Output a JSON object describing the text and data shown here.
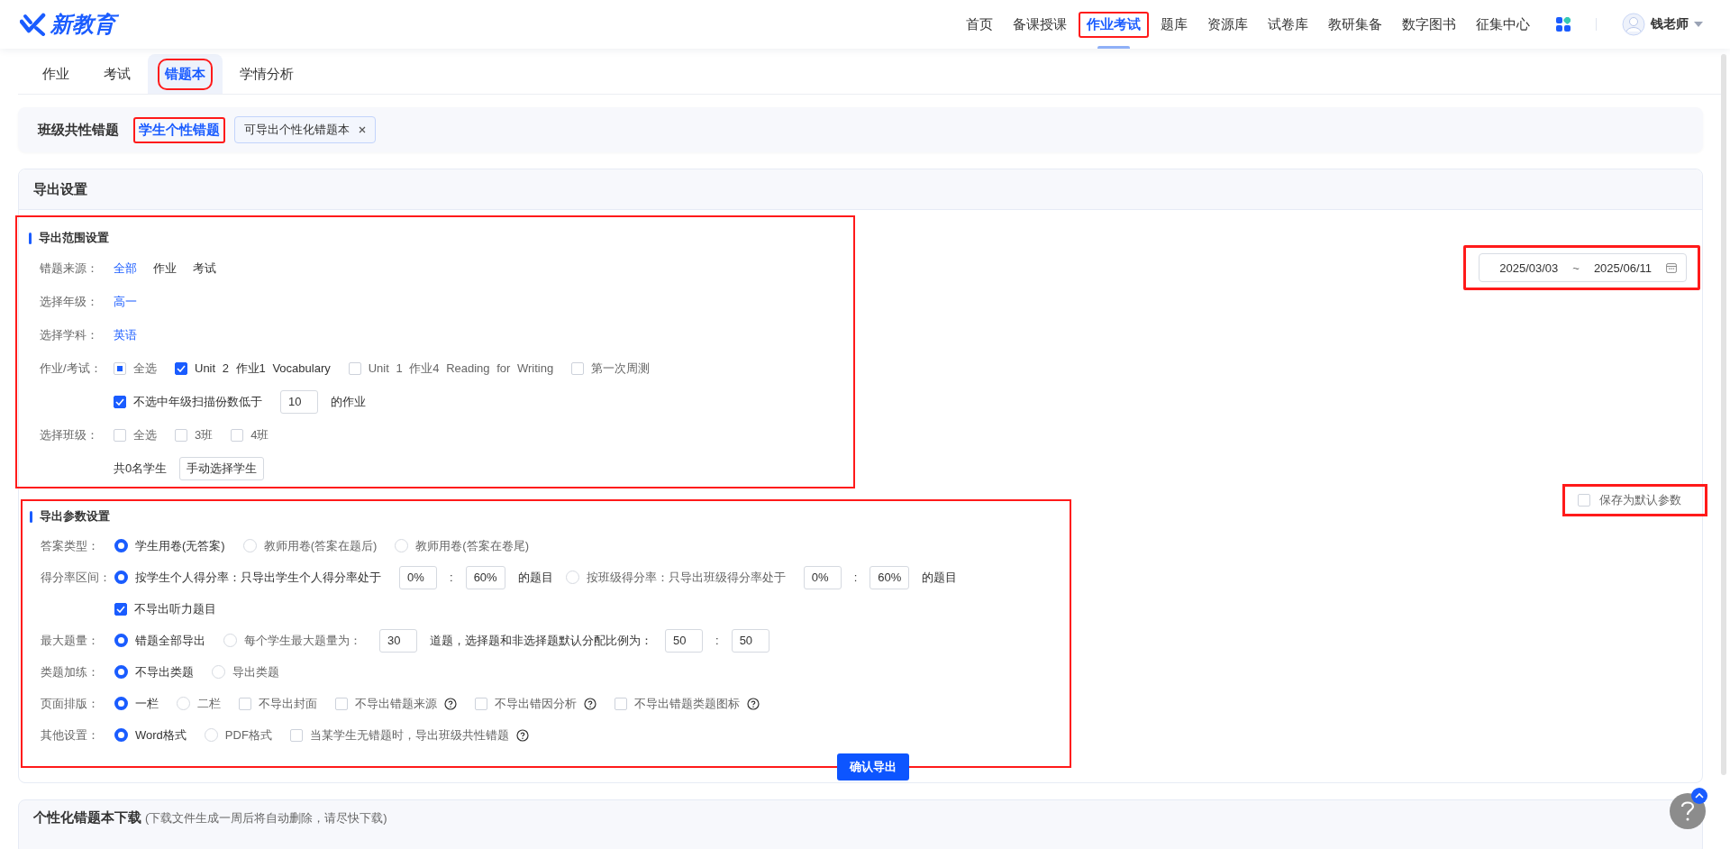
{
  "header": {
    "logo": "新教育",
    "nav": [
      {
        "label": "首页",
        "selected": false,
        "highlighted": false
      },
      {
        "label": "备课授课",
        "selected": false,
        "highlighted": false
      },
      {
        "label": "作业考试",
        "selected": true,
        "highlighted": true
      },
      {
        "label": "题库",
        "selected": false,
        "highlighted": false
      },
      {
        "label": "资源库",
        "selected": false,
        "highlighted": false
      },
      {
        "label": "试卷库",
        "selected": false,
        "highlighted": false
      },
      {
        "label": "教研集备",
        "selected": false,
        "highlighted": false
      },
      {
        "label": "数字图书",
        "selected": false,
        "highlighted": false
      },
      {
        "label": "征集中心",
        "selected": false,
        "highlighted": false
      }
    ],
    "user": {
      "name": "钱老师"
    }
  },
  "tabs": [
    {
      "label": "作业",
      "selected": false,
      "highlighted": false
    },
    {
      "label": "考试",
      "selected": false,
      "highlighted": false
    },
    {
      "label": "错题本",
      "selected": true,
      "highlighted": true
    },
    {
      "label": "学情分析",
      "selected": false,
      "highlighted": false
    }
  ],
  "subtabs": [
    {
      "label": "班级共性错题",
      "selected": false,
      "highlighted": false
    },
    {
      "label": "学生个性错题",
      "selected": true,
      "highlighted": true
    }
  ],
  "hint_tag": {
    "label": "可导出个性化错题本"
  },
  "export_settings": {
    "title": "导出设置",
    "date_range": {
      "start": "2025/03/03",
      "separator": "~",
      "end": "2025/06/11",
      "highlighted": true
    },
    "save_default": {
      "label": "保存为默认参数",
      "checked": false,
      "highlighted": true
    },
    "range_section": {
      "title": "导出范围设置",
      "highlighted": true,
      "rows": [
        {
          "label": "错题来源：",
          "items": [
            {
              "kind": "choice",
              "label": "全部",
              "selected": true
            },
            {
              "kind": "choice",
              "label": "作业",
              "selected": false
            },
            {
              "kind": "choice",
              "label": "考试",
              "selected": false
            }
          ]
        },
        {
          "label": "选择年级：",
          "items": [
            {
              "kind": "choice",
              "label": "高一",
              "selected": true
            }
          ]
        },
        {
          "label": "选择学科：",
          "items": [
            {
              "kind": "choice",
              "label": "英语",
              "selected": true
            }
          ]
        },
        {
          "label": "作业/考试：",
          "items": [
            {
              "kind": "checkbox",
              "label": "全选",
              "indeterminate": true
            },
            {
              "kind": "checkbox",
              "label": "Unit 2 作业1 Vocabulary",
              "checked": true
            },
            {
              "kind": "checkbox",
              "label": "Unit 1 作业4 Reading for Writing",
              "checked": false
            },
            {
              "kind": "checkbox",
              "label": "第一次周测",
              "checked": false
            }
          ]
        },
        {
          "items": [
            {
              "kind": "checkbox",
              "label": "不选中年级扫描份数低于",
              "checked": true
            },
            {
              "kind": "input",
              "value": "10"
            },
            {
              "kind": "text",
              "text": "的作业"
            }
          ]
        },
        {
          "label": "选择班级：",
          "items": [
            {
              "kind": "checkbox",
              "label": "全选",
              "checked": false
            },
            {
              "kind": "checkbox",
              "label": "3班",
              "checked": false
            },
            {
              "kind": "checkbox",
              "label": "4班",
              "checked": false
            }
          ]
        },
        {
          "items": [
            {
              "kind": "text",
              "text": "共0名学生"
            },
            {
              "kind": "button",
              "label": "手动选择学生"
            }
          ]
        }
      ]
    },
    "param_section": {
      "title": "导出参数设置",
      "highlighted": true,
      "confirm_button": "确认导出",
      "rows": [
        {
          "label": "答案类型：",
          "items": [
            {
              "kind": "radio",
              "label": "学生用卷(无答案)",
              "selected": true
            },
            {
              "kind": "radio",
              "label": "教师用卷(答案在题后)",
              "selected": false
            },
            {
              "kind": "radio",
              "label": "教师用卷(答案在卷尾)",
              "selected": false
            }
          ]
        },
        {
          "label": "得分率区间：",
          "items": [
            {
              "kind": "radio",
              "label": "按学生个人得分率：只导出学生个人得分率处于",
              "selected": true
            },
            {
              "kind": "input",
              "value": "0%"
            },
            {
              "kind": "text",
              "text": ":"
            },
            {
              "kind": "input",
              "value": "60%"
            },
            {
              "kind": "text",
              "text": "的题目"
            },
            {
              "kind": "radio",
              "label": "按班级得分率：只导出班级得分率处于",
              "selected": false
            },
            {
              "kind": "input",
              "value": "0%"
            },
            {
              "kind": "text",
              "text": ":"
            },
            {
              "kind": "input",
              "value": "60%"
            },
            {
              "kind": "text",
              "text": "的题目"
            }
          ]
        },
        {
          "items": [
            {
              "kind": "checkbox",
              "label": "不导出听力题目",
              "checked": true
            }
          ]
        },
        {
          "label": "最大题量：",
          "items": [
            {
              "kind": "radio",
              "label": "错题全部导出",
              "selected": true
            },
            {
              "kind": "radio",
              "label": "每个学生最大题量为：",
              "selected": false
            },
            {
              "kind": "input",
              "value": "30"
            },
            {
              "kind": "text",
              "text": "道题，选择题和非选择题默认分配比例为："
            },
            {
              "kind": "input",
              "value": "50"
            },
            {
              "kind": "text",
              "text": ":"
            },
            {
              "kind": "input",
              "value": "50"
            }
          ]
        },
        {
          "label": "类题加练：",
          "items": [
            {
              "kind": "radio",
              "label": "不导出类题",
              "selected": true
            },
            {
              "kind": "radio",
              "label": "导出类题",
              "selected": false
            }
          ]
        },
        {
          "label": "页面排版：",
          "items": [
            {
              "kind": "radio",
              "label": "一栏",
              "selected": true
            },
            {
              "kind": "radio",
              "label": "二栏",
              "selected": false
            },
            {
              "kind": "checkbox",
              "label": "不导出封面",
              "checked": false
            },
            {
              "kind": "checkbox",
              "label": "不导出错题来源",
              "checked": false,
              "help": true
            },
            {
              "kind": "checkbox",
              "label": "不导出错因分析",
              "checked": false,
              "help": true
            },
            {
              "kind": "checkbox",
              "label": "不导出错题类题图标",
              "checked": false,
              "help": true
            }
          ]
        },
        {
          "label": "其他设置：",
          "items": [
            {
              "kind": "radio",
              "label": "Word格式",
              "selected": true
            },
            {
              "kind": "radio",
              "label": "PDF格式",
              "selected": false
            },
            {
              "kind": "checkbox",
              "label": "当某学生无错题时，导出班级共性错题",
              "checked": false,
              "help": true
            }
          ]
        }
      ]
    }
  },
  "download_section": {
    "title": "个性化错题本下载",
    "note": "(下载文件生成一周后将自动删除，请尽快下载)"
  }
}
